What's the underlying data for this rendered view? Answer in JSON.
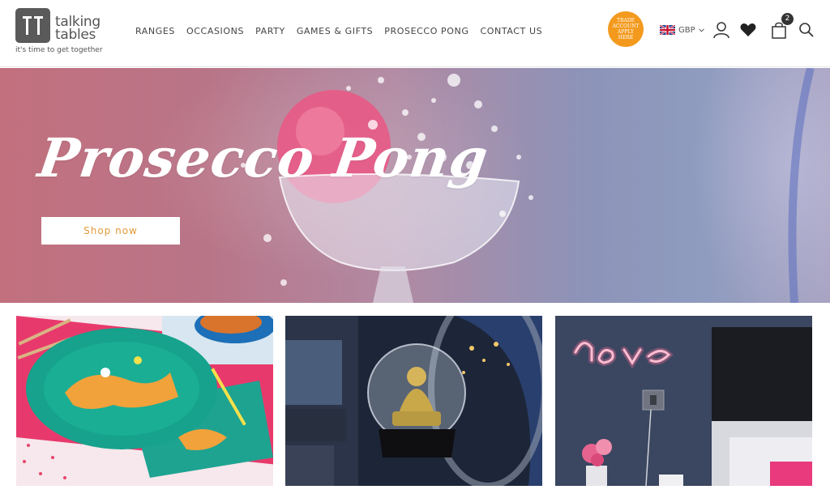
{
  "brand": {
    "name_line1": "talking",
    "name_line2": "tables",
    "tagline": "it's time to get together"
  },
  "nav": {
    "items": [
      {
        "label": "RANGES"
      },
      {
        "label": "OCCASIONS"
      },
      {
        "label": "PARTY"
      },
      {
        "label": "GAMES & GIFTS"
      },
      {
        "label": "PROSECCO PONG"
      },
      {
        "label": "CONTACT US"
      }
    ]
  },
  "trade_badge": {
    "line1": "TRADE",
    "line2": "ACCOUNT",
    "line3": "APPLY",
    "line4": "HERE"
  },
  "currency": {
    "code": "GBP",
    "flag_icon": "uk-flag-icon"
  },
  "icons": {
    "account": "user-icon",
    "wishlist": "heart-icon",
    "cart": "shopping-bag-icon",
    "search": "search-icon"
  },
  "cart": {
    "count": "2"
  },
  "hero": {
    "title": "Prosecco Pong",
    "cta": "Shop now"
  },
  "tiles": [
    {
      "name": "party-plates-tile"
    },
    {
      "name": "snow-globe-tile"
    },
    {
      "name": "neon-love-tile"
    }
  ],
  "colors": {
    "accent": "#f39a1e",
    "cta_text": "#e29a3a",
    "text": "#444444"
  }
}
